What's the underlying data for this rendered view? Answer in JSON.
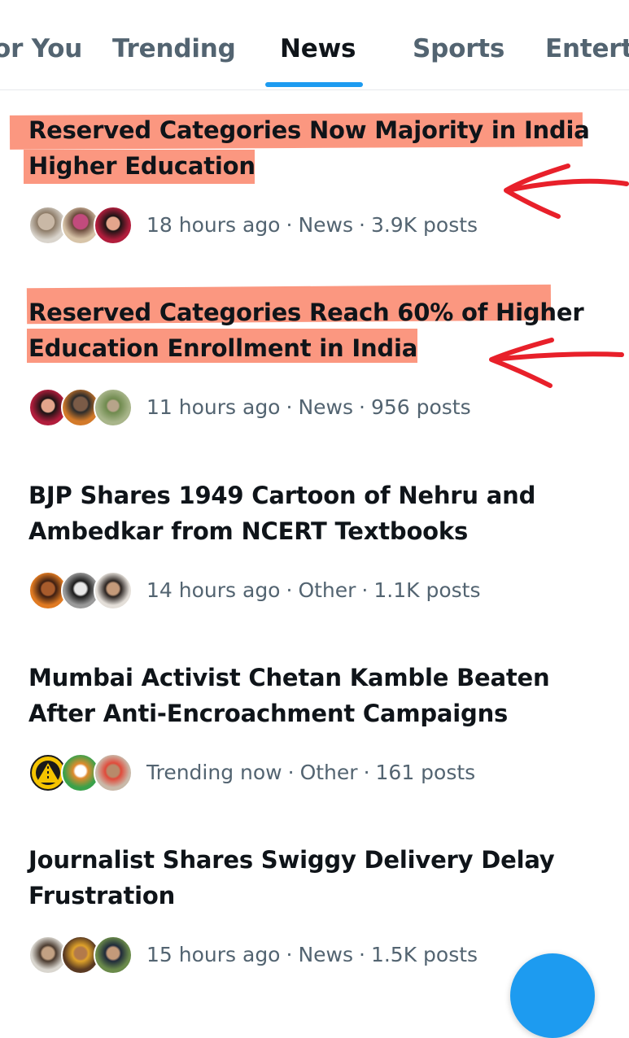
{
  "tabs": [
    {
      "label": "or You"
    },
    {
      "label": "Trending"
    },
    {
      "label": "News"
    },
    {
      "label": "Sports"
    },
    {
      "label": "Enterta"
    }
  ],
  "active_tab": "News",
  "trends": [
    {
      "line1": "Reserved Categories Now Majority in India",
      "line2": "Higher Education",
      "time": "18 hours ago",
      "category": "News",
      "posts": "3.9K posts",
      "separator": "·",
      "highlighted": true
    },
    {
      "line1": "Reserved Categories Reach 60% of Higher",
      "line2": "Education Enrollment in India",
      "time": "11 hours ago",
      "category": "News",
      "posts": "956 posts",
      "separator": "·",
      "highlighted": true
    },
    {
      "line1": "BJP Shares 1949 Cartoon of Nehru and",
      "line2": "Ambedkar from NCERT Textbooks",
      "time": "14 hours ago",
      "category": "Other",
      "posts": "1.1K posts",
      "separator": "·",
      "highlighted": false
    },
    {
      "line1": "Mumbai Activist Chetan Kamble Beaten",
      "line2": "After Anti-Encroachment Campaigns",
      "time": "Trending now",
      "category": "Other",
      "posts": "161 posts",
      "separator": "·",
      "highlighted": false
    },
    {
      "line1": "Journalist Shares Swiggy Delivery Delay",
      "line2": "Frustration",
      "time": "15 hours ago",
      "category": "News",
      "posts": "1.5K posts",
      "separator": "·",
      "highlighted": false
    }
  ],
  "colors": {
    "accent": "#1d9bf0",
    "highlight": "#fa8064",
    "annotation": "#e8202a",
    "meta_text": "#536471",
    "headline_text": "#0f1419"
  },
  "icons": [
    "user-avatar",
    "hand-drawn-arrow",
    "compose-fab"
  ]
}
